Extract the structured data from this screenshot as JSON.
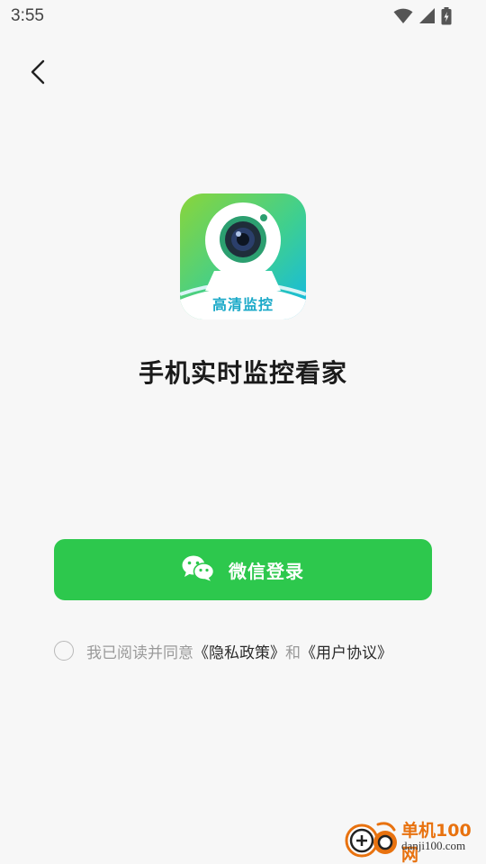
{
  "status_bar": {
    "time": "3:55",
    "icons": [
      "wifi-icon",
      "cellular-signal-icon",
      "battery-charging-icon"
    ]
  },
  "nav": {
    "back_icon": "chevron-left-icon"
  },
  "app": {
    "logo_label": "高清监控",
    "title": "手机实时监控看家"
  },
  "login": {
    "button_label": "微信登录",
    "button_icon": "wechat-icon"
  },
  "agreement": {
    "prefix": "我已阅读并同意",
    "privacy_link": "《隐私政策》",
    "and": "和",
    "user_link": "《用户协议》"
  },
  "watermark": {
    "name": "单机100网",
    "url": "danji100.com"
  },
  "colors": {
    "primary_green": "#2dc84d",
    "background": "#f7f7f7",
    "watermark_orange": "#e8720f"
  }
}
